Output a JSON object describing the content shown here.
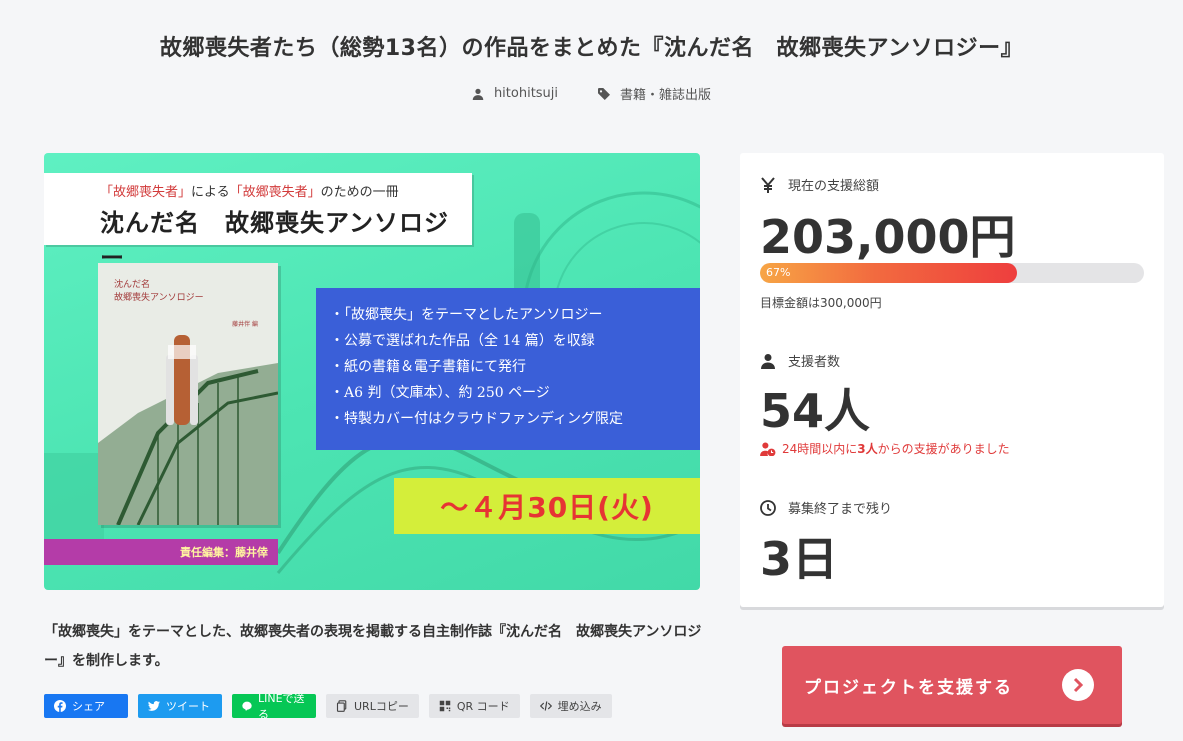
{
  "page": {
    "title": "故郷喪失者たち（総勢13名）の作品をまとめた『沈んだ名　故郷喪失アンソロジー』",
    "author": "hitohitsuji",
    "category": "書籍・雑誌出版"
  },
  "hero": {
    "banner_sub_quote1": "「故郷喪失者」",
    "banner_sub_mid": "による",
    "banner_sub_quote2": "「故郷喪失者」",
    "banner_sub_end": "のための一冊",
    "banner_title": "沈んだ名　故郷喪失アンソロジー",
    "book_title_line1": "沈んだ名",
    "book_title_line2": "故郷喪失アンソロジー",
    "book_author": "藤井伴 編",
    "features": [
      "・「故郷喪失」をテーマとしたアンソロジー",
      "・公募で選ばれた作品（全 14 篇）を収録",
      "・紙の書籍＆電子書籍にて発行",
      "・A6 判（文庫本）、約 250 ページ",
      "・特製カバー付はクラウドファンディング限定"
    ],
    "date": "〜４月30日(火)",
    "editor": "責任編集：藤井倖"
  },
  "description": "「故郷喪失」をテーマとした、故郷喪失者の表現を掲載する自主制作誌『沈んだ名　故郷喪失アンソロジー』を制作します。",
  "share": {
    "facebook": "シェア",
    "twitter": "ツイート",
    "line": "LINEで送る",
    "url_copy": "URLコピー",
    "qr": "QR コード",
    "embed": "埋め込み"
  },
  "stats": {
    "total_label": "現在の支援総額",
    "total_value": "203,000円",
    "progress_percent": 67,
    "progress_text": "67%",
    "goal_text": "目標金額は300,000円",
    "supporters_label": "支援者数",
    "supporters_value": "54人",
    "recent_prefix": "24時間以内に",
    "recent_count": "3人",
    "recent_suffix": "からの支援がありました",
    "remaining_label": "募集終了まで残り",
    "remaining_value": "3日"
  },
  "cta": {
    "support_label": "プロジェクトを支援する"
  },
  "colors": {
    "accent_red": "#e0545f",
    "progress_start": "#f7a545",
    "progress_end": "#ee3e3e",
    "alert_red": "#e03a3a"
  }
}
